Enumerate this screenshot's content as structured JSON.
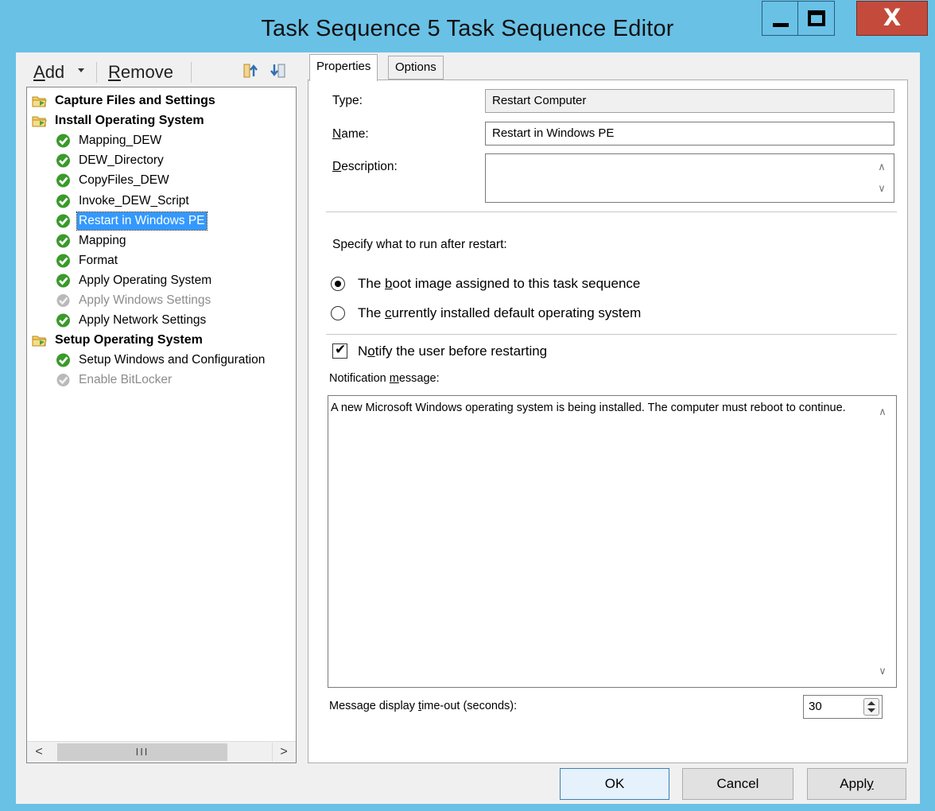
{
  "window": {
    "title": "Task Sequence 5 Task Sequence Editor",
    "close_glyph": "X"
  },
  "toolbar": {
    "add_label_first": "A",
    "add_label_rest": "dd",
    "remove_label_first": "R",
    "remove_label_rest": "emove"
  },
  "tree": {
    "items": [
      {
        "label": "Capture Files and Settings",
        "kind": "group"
      },
      {
        "label": "Install Operating System",
        "kind": "group"
      },
      {
        "label": "Mapping_DEW",
        "kind": "step"
      },
      {
        "label": "DEW_Directory",
        "kind": "step"
      },
      {
        "label": "CopyFiles_DEW",
        "kind": "step"
      },
      {
        "label": "Invoke_DEW_Script",
        "kind": "step"
      },
      {
        "label": "Restart in Windows PE",
        "kind": "step",
        "selected": true
      },
      {
        "label": "Mapping",
        "kind": "step"
      },
      {
        "label": "Format",
        "kind": "step"
      },
      {
        "label": "Apply Operating System",
        "kind": "step"
      },
      {
        "label": "Apply Windows Settings",
        "kind": "disabled"
      },
      {
        "label": "Apply Network Settings",
        "kind": "step"
      },
      {
        "label": "Setup Operating System",
        "kind": "group"
      },
      {
        "label": "Setup Windows and Configuration",
        "kind": "step"
      },
      {
        "label": "Enable BitLocker",
        "kind": "disabled"
      }
    ],
    "hscroll_thumb": "III"
  },
  "tabs": {
    "properties": "Properties",
    "options": "Options"
  },
  "properties": {
    "type_label": "Type:",
    "type_value": "Restart Computer",
    "name_label_first": "N",
    "name_label_rest": "ame:",
    "name_value": "Restart in Windows PE",
    "description_label_first": "D",
    "description_label_rest": "escription:",
    "description_value": "",
    "specify_label": "Specify what to run after restart:",
    "radio_boot_pre": "The ",
    "radio_boot_u": "b",
    "radio_boot_post": "oot image assigned to this task sequence",
    "radio_installed_pre": "The ",
    "radio_installed_u": "c",
    "radio_installed_post": "urrently installed default operating system",
    "notify_pre": "N",
    "notify_u": "o",
    "notify_post": "tify the user before restarting",
    "notify_checked": true,
    "notification_label_pre": "Notification ",
    "notification_label_u": "m",
    "notification_label_post": "essage:",
    "notification_message": "A new Microsoft Windows operating system is being installed.  The computer must reboot to continue.",
    "timeout_label_pre": "Message display ",
    "timeout_label_u": "t",
    "timeout_label_post": "ime-out (seconds):",
    "timeout_value": "30"
  },
  "buttons": {
    "ok": "OK",
    "cancel": "Cancel",
    "apply_pre": "Appl",
    "apply_u": "y"
  },
  "colors": {
    "titlebar": "#69c1e6",
    "close": "#c44b3c",
    "selection": "#3399ff",
    "check_green": "#3a9a2a"
  }
}
